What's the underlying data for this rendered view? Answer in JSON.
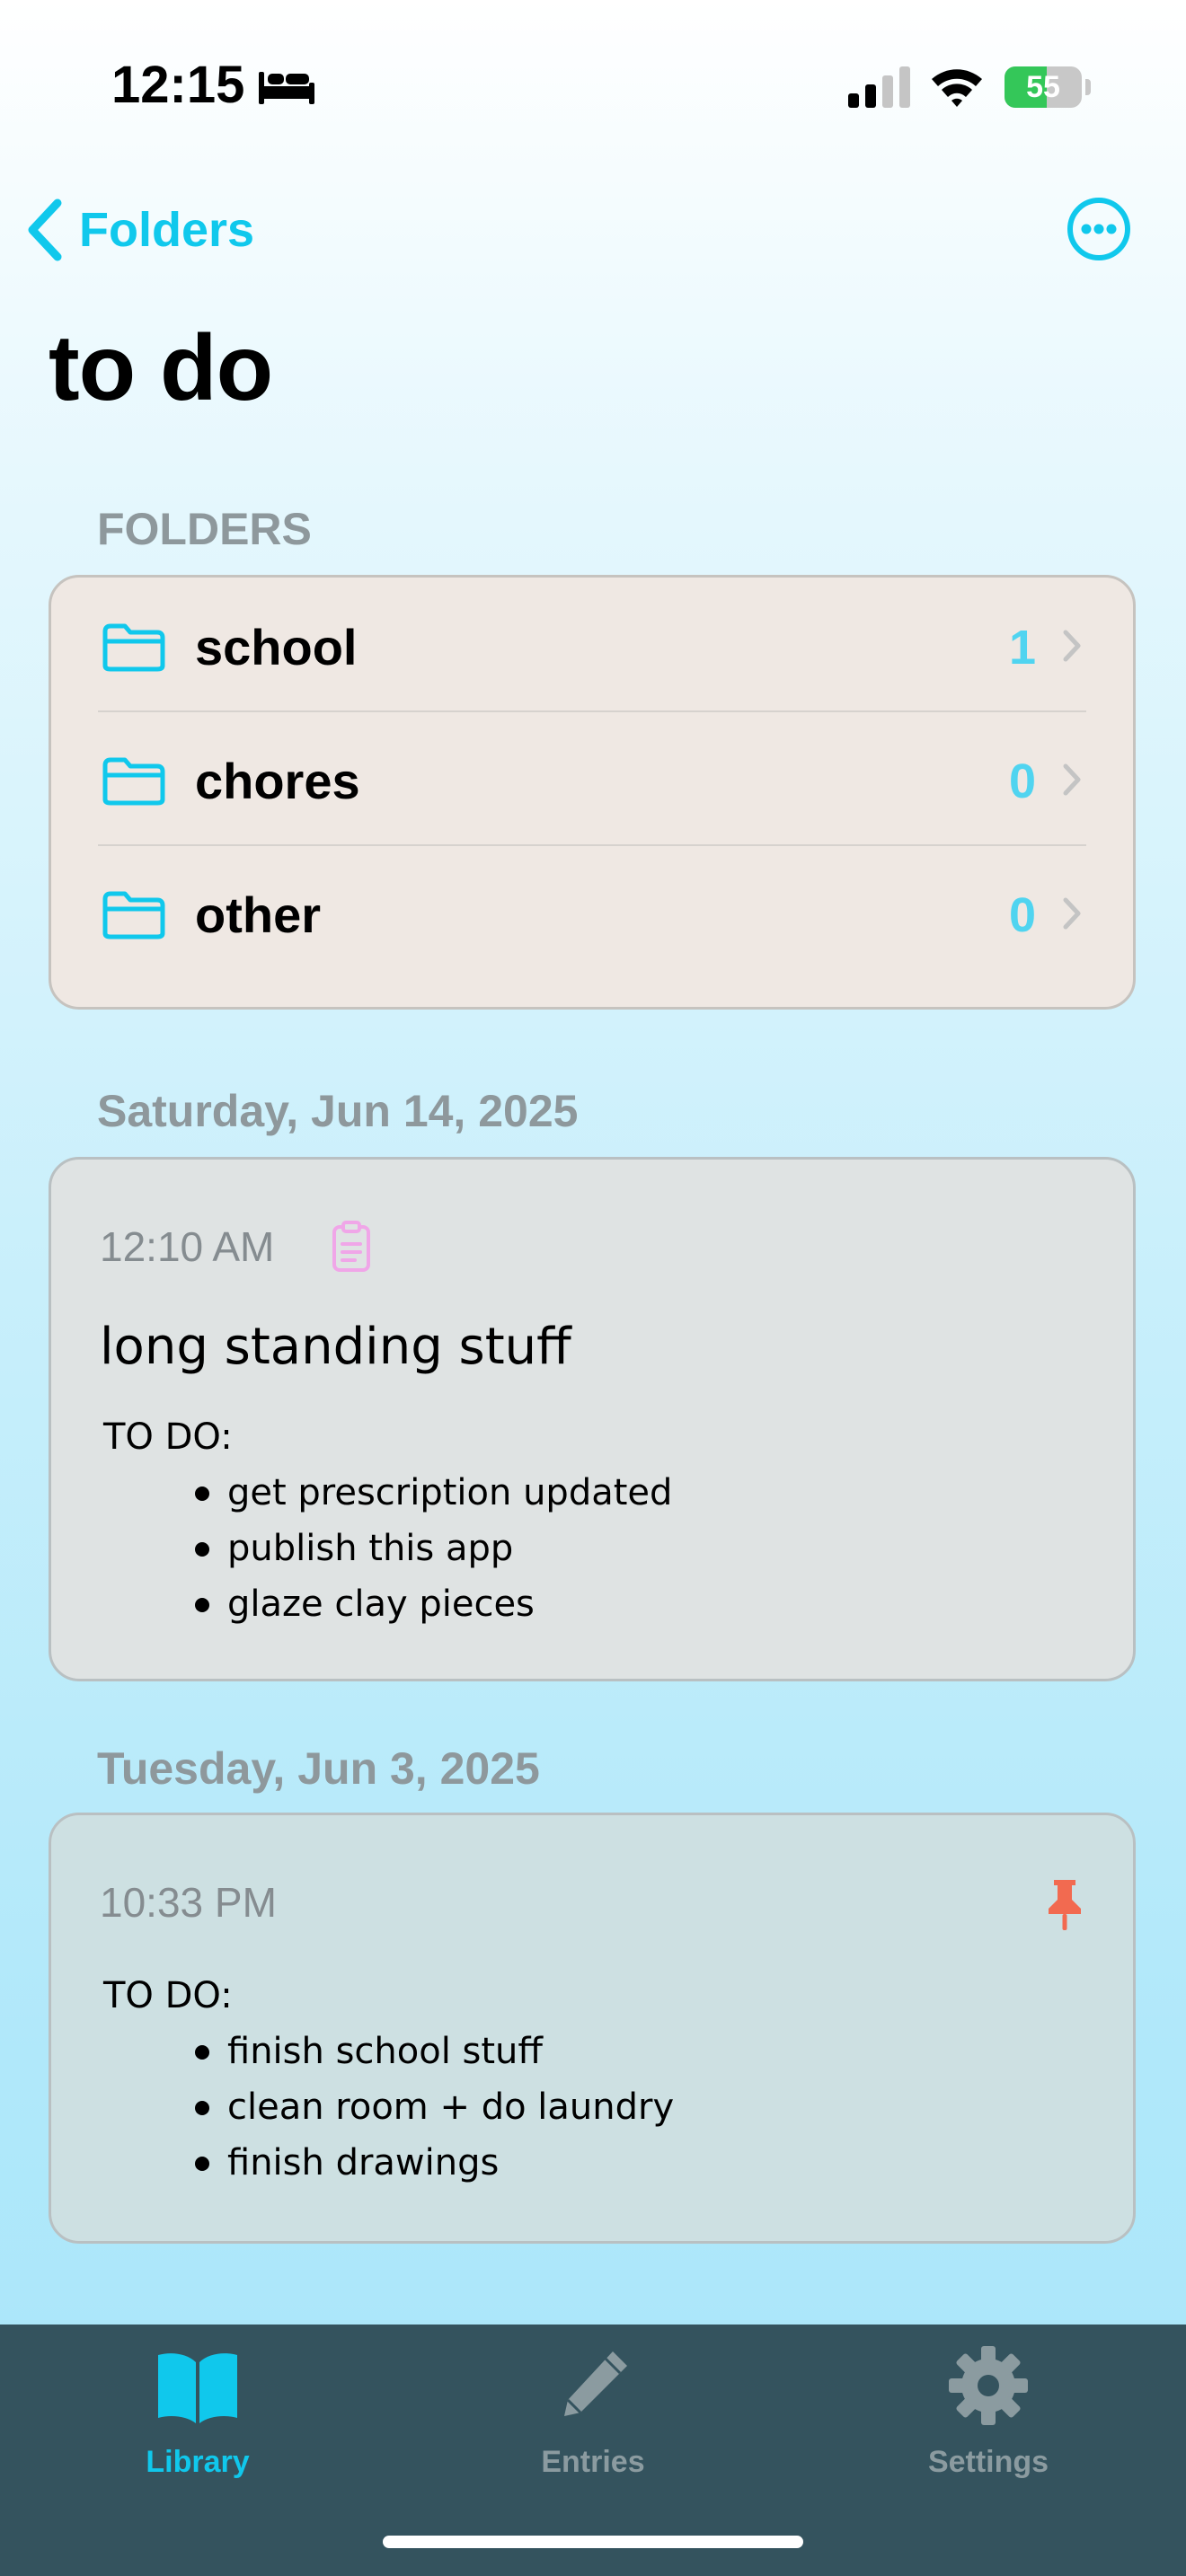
{
  "status_bar": {
    "time": "12:15",
    "battery_percent": "55",
    "battery_level": 0.55,
    "focus_icon": "bed-icon",
    "signal_icon": "cellular-signal-icon",
    "wifi_icon": "wifi-icon"
  },
  "nav": {
    "back_label": "Folders",
    "more_icon": "ellipsis-circle-icon"
  },
  "page_title": "to do",
  "folders_section": {
    "header": "FOLDERS",
    "items": [
      {
        "name": "school",
        "count": "1"
      },
      {
        "name": "chores",
        "count": "0"
      },
      {
        "name": "other",
        "count": "0"
      }
    ]
  },
  "entries": [
    {
      "date": "Saturday, Jun 14, 2025",
      "time": "12:10 AM",
      "icon": "clipboard-icon",
      "title": "long standing stuff",
      "heading": "TO DO:",
      "items": [
        "get prescription updated",
        "publish this app",
        "glaze clay pieces"
      ]
    },
    {
      "date": "Tuesday, Jun 3, 2025",
      "time": "10:33 PM",
      "icon": "pin-icon",
      "heading": "TO DO:",
      "items": [
        "finish school stuff",
        "clean room + do laundry",
        "finish drawings"
      ]
    }
  ],
  "tab_bar": {
    "tabs": [
      {
        "label": "Library",
        "icon": "book-icon",
        "active": true
      },
      {
        "label": "Entries",
        "icon": "pencil-icon",
        "active": false
      },
      {
        "label": "Settings",
        "icon": "gear-icon",
        "active": false
      }
    ]
  },
  "colors": {
    "accent": "#10c8ec",
    "pin": "#f26a50",
    "clipboard": "#f0a6e8",
    "tab_bar": "#34535e"
  }
}
